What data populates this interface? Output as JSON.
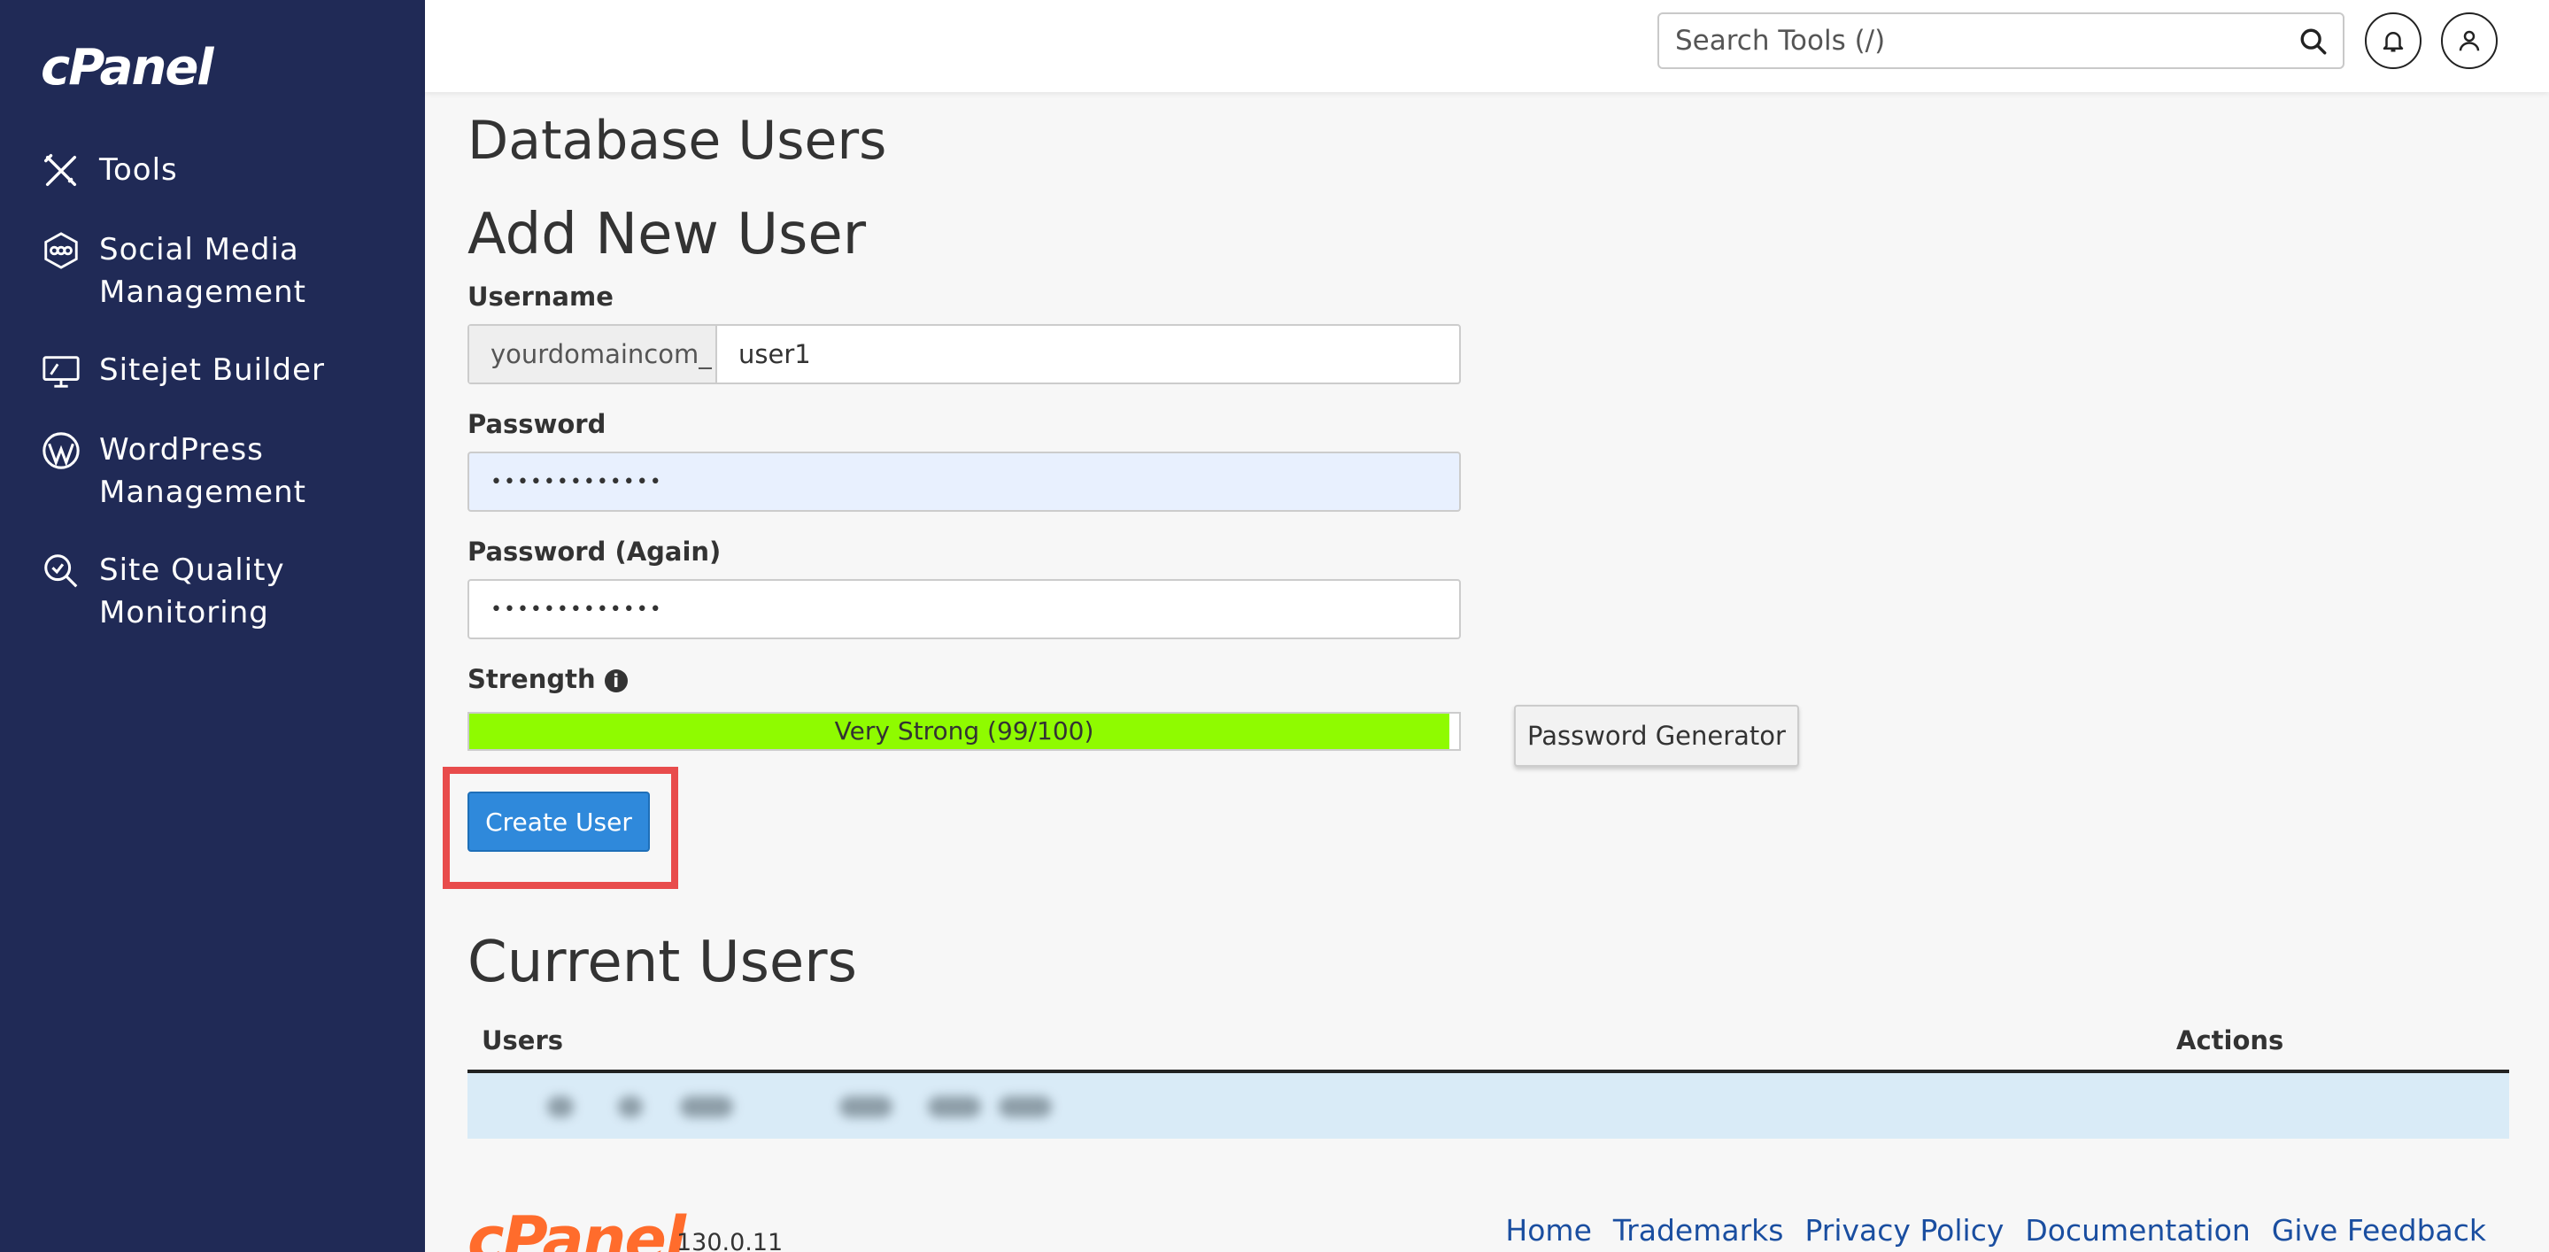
{
  "brand": {
    "logo": "cPanel"
  },
  "sidebar": {
    "items": [
      {
        "label": "Tools",
        "icon": "tools-icon"
      },
      {
        "label": "Social Media Management",
        "icon": "social-media-icon"
      },
      {
        "label": "Sitejet Builder",
        "icon": "sitejet-icon"
      },
      {
        "label": "WordPress Management",
        "icon": "wordpress-icon"
      },
      {
        "label": "Site Quality Monitoring",
        "icon": "site-quality-icon"
      }
    ]
  },
  "header": {
    "search_placeholder": "Search Tools (/)",
    "icons": [
      "search-icon",
      "bell-icon",
      "user-icon"
    ]
  },
  "page": {
    "title": "Database Users",
    "add_section": {
      "heading": "Add New User",
      "username_label": "Username",
      "username_prefix": "yourdomaincom_",
      "username_value": "user1",
      "password_label": "Password",
      "password_value": "•••••••••••••",
      "password_again_label": "Password (Again)",
      "password_again_value": "•••••••••••••",
      "strength_label": "Strength",
      "strength_text": "Very Strong (99/100)",
      "strength_value": 99,
      "generator_button": "Password Generator",
      "create_button": "Create User"
    },
    "current_section": {
      "heading": "Current Users",
      "columns": [
        "Users",
        "Actions"
      ]
    }
  },
  "footer": {
    "logo": "cPanel",
    "version": "130.0.11",
    "links": [
      "Home",
      "Trademarks",
      "Privacy Policy",
      "Documentation",
      "Give Feedback"
    ]
  },
  "colors": {
    "sidebar_bg": "#202a56",
    "primary_button": "#2f89db",
    "strength_fill": "#8ffb00",
    "highlight_border": "#e84c4c",
    "footer_logo": "#ff6c2c"
  }
}
